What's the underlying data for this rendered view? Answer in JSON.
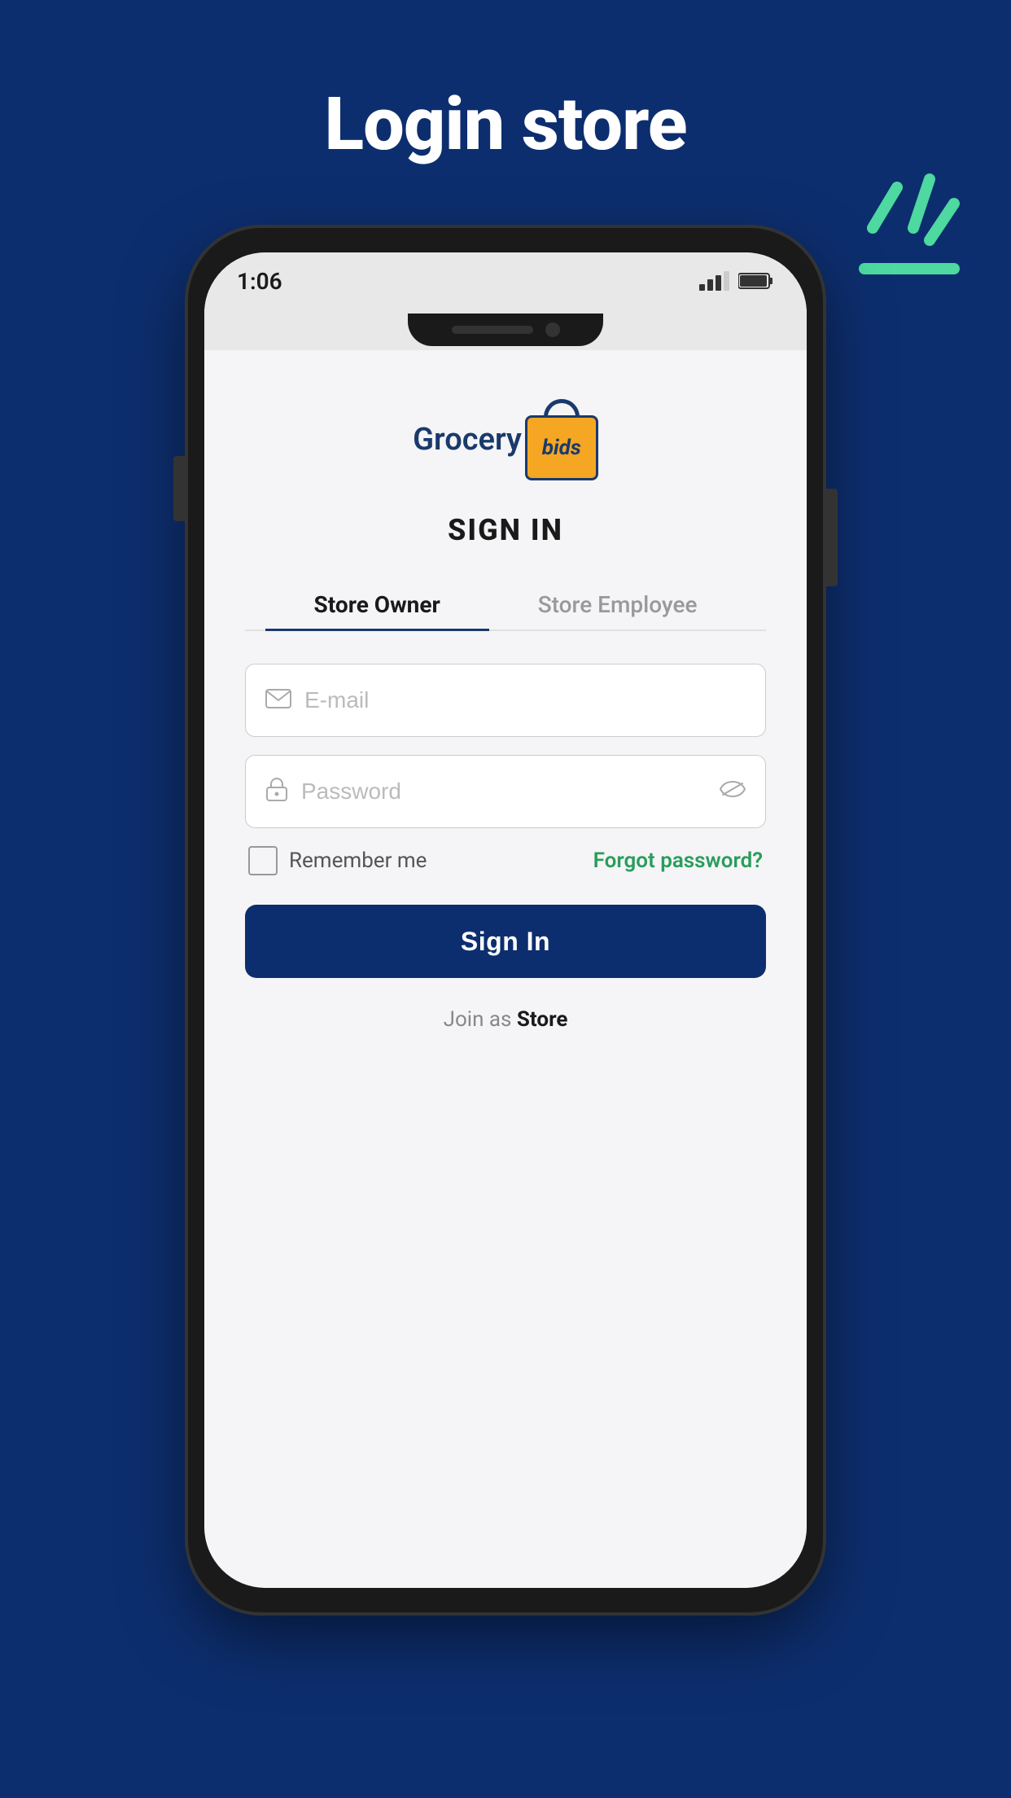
{
  "page": {
    "background_color": "#0d2e6e",
    "title": "Login store"
  },
  "phone": {
    "status_bar": {
      "time": "1:06",
      "battery": "96%"
    }
  },
  "app": {
    "logo": {
      "text_left": "Grocery",
      "text_bag": "bids"
    },
    "sign_in_title": "SIGN IN",
    "tabs": [
      {
        "label": "Store Owner",
        "active": true
      },
      {
        "label": "Store Employee",
        "active": false
      }
    ],
    "email_placeholder": "E-mail",
    "password_placeholder": "Password",
    "remember_me_label": "Remember me",
    "forgot_password_label": "Forgot password?",
    "sign_in_button_label": "Sign In",
    "join_text_prefix": "Join as ",
    "join_text_bold": "Store"
  }
}
